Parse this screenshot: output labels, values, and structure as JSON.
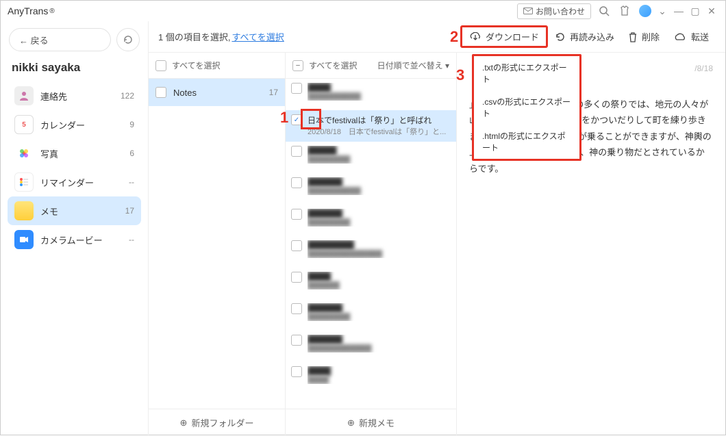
{
  "titlebar": {
    "app_name": "AnyTrans",
    "reg_mark": "®",
    "contact_label": "お問い合わせ"
  },
  "sidebar": {
    "back_label": "← 戻る",
    "account": "nikki sayaka",
    "items": [
      {
        "label": "連絡先",
        "count": "122"
      },
      {
        "label": "カレンダー",
        "count": "9"
      },
      {
        "label": "写真",
        "count": "6"
      },
      {
        "label": "リマインダー",
        "count": "--"
      },
      {
        "label": "メモ",
        "count": "17"
      },
      {
        "label": "カメラムービー",
        "count": "--"
      }
    ]
  },
  "toolbar": {
    "selected_text": "1 個の項目を選択,",
    "select_all_link": "すべてを選択",
    "download": "ダウンロード",
    "reload": "再読み込み",
    "delete": "削除",
    "transfer": "転送"
  },
  "col1": {
    "header": "すべてを選択",
    "folder_name": "Notes",
    "folder_count": "17",
    "footer": "新規フォルダー"
  },
  "col2": {
    "header": "すべてを選択",
    "sort_label": "日付順で並べ替え ▾",
    "selected_note_title": "日本でfestivalは「祭り」と呼ばれ",
    "selected_note_sub": "2020/8/18　日本でfestivalは「祭り」と...",
    "footer": "新規メモ"
  },
  "col3": {
    "date_faint": "/8/18",
    "body": "」と呼ばれています。日本の多くの祭りでは、地元の人々が山車(だし)をひいたり、神輿をかついだりして町を練り歩きます。　...　山車の上には人が乗ることができますが、神輿の上には乗れません。　神輿は、神の乗り物だとされているからです。"
  },
  "dropdown": {
    "txt": ".txtの形式にエクスポート",
    "csv": ".csvの形式にエクスポート",
    "html": ".htmlの形式にエクスポート"
  },
  "annotations": {
    "n1": "1",
    "n2": "2",
    "n3": "3"
  }
}
